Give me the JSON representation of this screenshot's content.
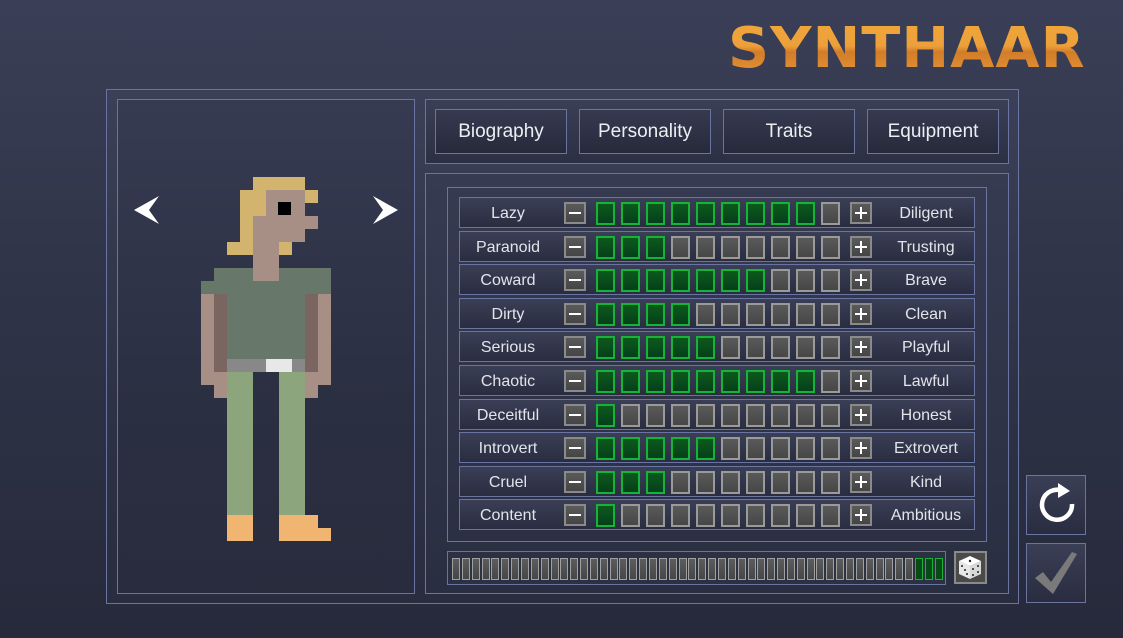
{
  "title": "SYNTHAAR",
  "tabs": [
    {
      "label": "Biography"
    },
    {
      "label": "Personality"
    },
    {
      "label": "Traits"
    },
    {
      "label": "Equipment"
    }
  ],
  "character_nav": {
    "prev_icon": "chevron-left-icon",
    "next_icon": "chevron-right-icon"
  },
  "traits_max": 10,
  "traits": [
    {
      "left": "Lazy",
      "right": "Diligent",
      "value": 9
    },
    {
      "left": "Paranoid",
      "right": "Trusting",
      "value": 3
    },
    {
      "left": "Coward",
      "right": "Brave",
      "value": 7
    },
    {
      "left": "Dirty",
      "right": "Clean",
      "value": 4
    },
    {
      "left": "Serious",
      "right": "Playful",
      "value": 5
    },
    {
      "left": "Chaotic",
      "right": "Lawful",
      "value": 9
    },
    {
      "left": "Deceitful",
      "right": "Honest",
      "value": 1
    },
    {
      "left": "Introvert",
      "right": "Extrovert",
      "value": 5
    },
    {
      "left": "Cruel",
      "right": "Kind",
      "value": 3
    },
    {
      "left": "Content",
      "right": "Ambitious",
      "value": 1
    }
  ],
  "points_bar": {
    "total_segments": 50,
    "remaining": 3
  },
  "colors": {
    "accent_on": "#16b23a",
    "logo": "#eda03a"
  },
  "icons": {
    "randomize": "dice-icon",
    "reset": "refresh-icon",
    "confirm": "checkmark-icon"
  }
}
